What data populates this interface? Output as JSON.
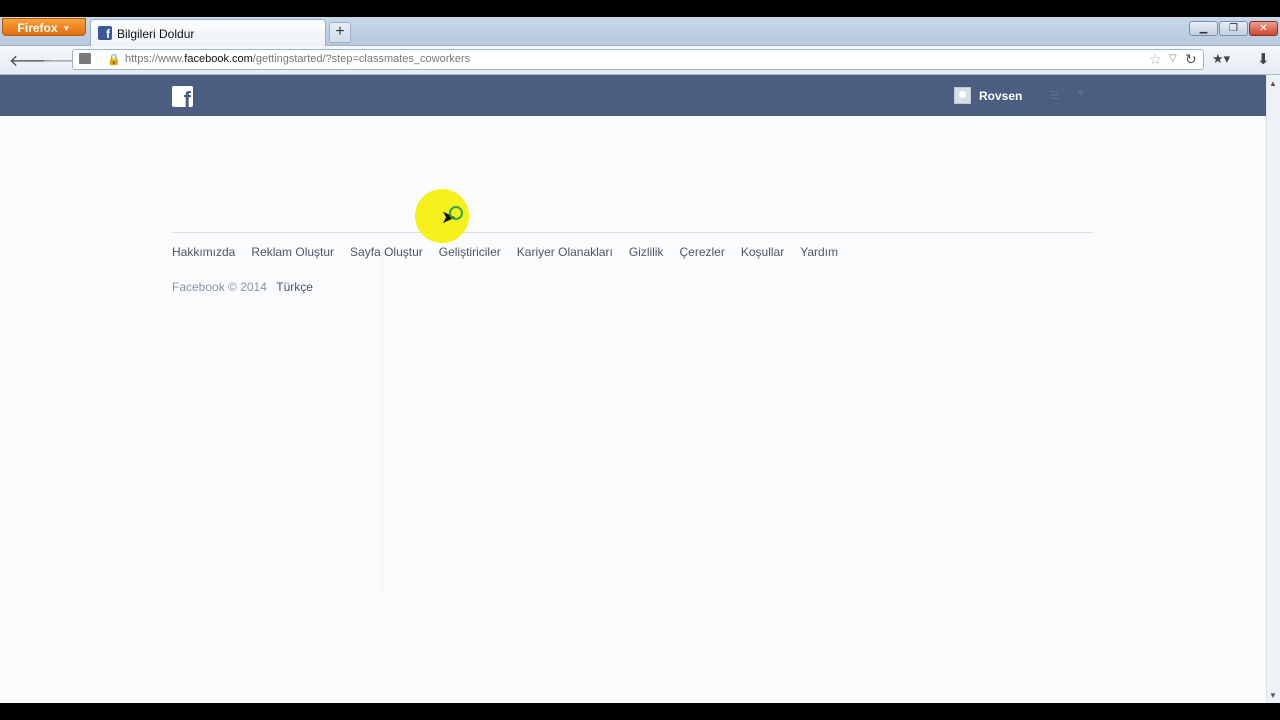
{
  "browser": {
    "app_button": "Firefox",
    "tab": {
      "title": "Bilgileri Doldur"
    },
    "new_tab_label": "+",
    "url": {
      "prefix": "https://www.",
      "domain": "facebook.com",
      "path": "/gettingstarted/?step=classmates_coworkers"
    }
  },
  "header": {
    "user_name": "Rovsen"
  },
  "footer": {
    "links": [
      "Hakkımızda",
      "Reklam Oluştur",
      "Sayfa Oluştur",
      "Geliştiriciler",
      "Kariyer Olanakları",
      "Gizlilik",
      "Çerezler",
      "Koşullar",
      "Yardım"
    ],
    "copyright": "Facebook © 2014",
    "language": "Türkçe"
  },
  "colors": {
    "fb_header": "#4b5d80",
    "firefox_button": "#e46d0f",
    "cursor_highlight": "#f5ef10"
  },
  "icons": [
    "facebook-logo-icon",
    "back-arrow-icon",
    "forward-arrow-icon",
    "lock-icon",
    "star-icon",
    "reload-icon",
    "bookmarks-icon",
    "download-icon",
    "settings-icon"
  ]
}
